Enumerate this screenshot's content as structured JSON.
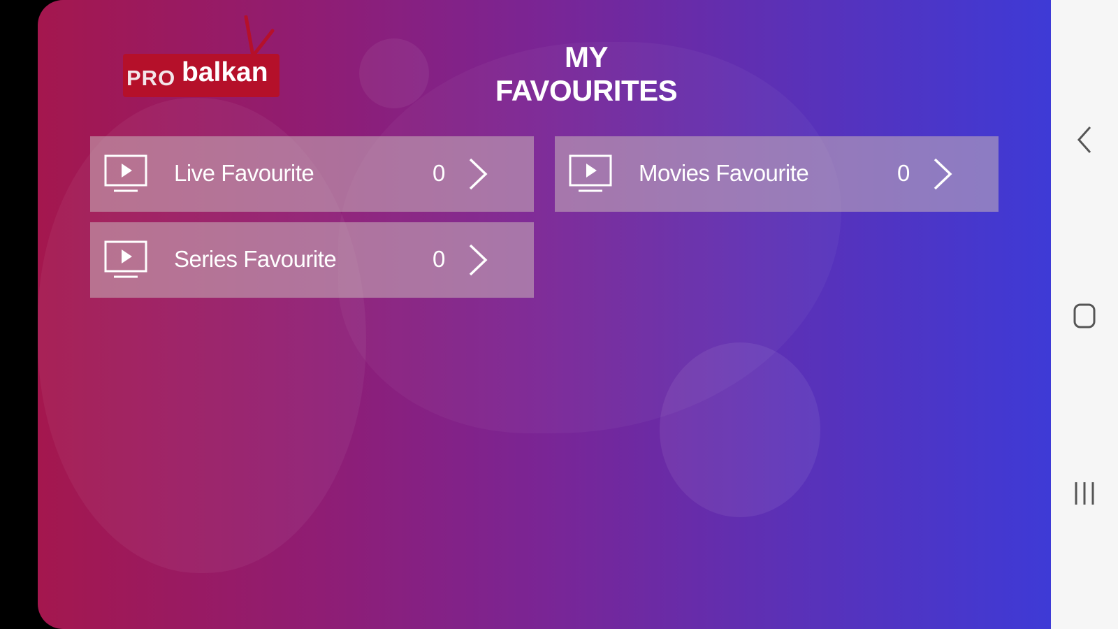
{
  "logo": {
    "pro": "PRO",
    "name": "balkan"
  },
  "header": {
    "title": "MY FAVOURITES"
  },
  "favourites": [
    {
      "label": "Live Favourite",
      "count": "0",
      "icon": "tv-play-icon"
    },
    {
      "label": "Movies Favourite",
      "count": "0",
      "icon": "tv-play-icon"
    },
    {
      "label": "Series Favourite",
      "count": "0",
      "icon": "tv-play-icon"
    }
  ],
  "navbar": {
    "back_icon": "back-chevron-icon",
    "home_icon": "home-square-icon",
    "recent_icon": "recent-apps-icon"
  },
  "colors": {
    "gradient_start": "#a4174e",
    "gradient_mid": "#7a2595",
    "gradient_end": "#3e3ad6",
    "logo_red": "#b5102a"
  }
}
